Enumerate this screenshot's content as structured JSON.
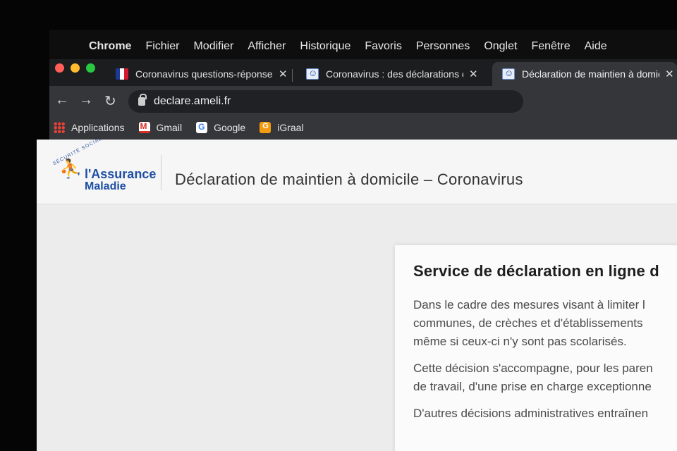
{
  "menubar": {
    "items": [
      "Chrome",
      "Fichier",
      "Modifier",
      "Afficher",
      "Historique",
      "Favoris",
      "Personnes",
      "Onglet",
      "Fenêtre",
      "Aide"
    ]
  },
  "tabs": [
    {
      "title": "Coronavirus questions-réponses",
      "favicon": "french-flag-icon"
    },
    {
      "title": "Coronavirus : des déclarations d",
      "favicon": "ameli-icon"
    },
    {
      "title": "Déclaration de maintien à domicil",
      "favicon": "ameli-icon",
      "active": true
    }
  ],
  "toolbar": {
    "url": "declare.ameli.fr"
  },
  "bookmarks": [
    {
      "label": "Applications",
      "icon": "apps-grid-icon"
    },
    {
      "label": "Gmail",
      "icon": "gmail-icon"
    },
    {
      "label": "Google",
      "icon": "google-icon"
    },
    {
      "label": "iGraal",
      "icon": "igraal-icon"
    }
  ],
  "site": {
    "logo_top": "SÉCURITÉ SOCIALE",
    "logo_line1": "l'Assurance",
    "logo_line2": "Maladie",
    "page_title": "Déclaration de maintien à domicile – Coronavirus"
  },
  "card": {
    "heading": "Service de déclaration en ligne d",
    "p1": [
      "Dans le cadre des mesures visant à limiter l",
      "communes, de crèches et d'établissements",
      "même si ceux-ci n'y sont pas scolarisés."
    ],
    "p2": [
      "Cette décision s'accompagne, pour les paren",
      "de travail, d'une prise en charge exceptionne"
    ],
    "p3": [
      "D'autres décisions administratives entraînen"
    ]
  },
  "colors": {
    "accent": "#1f4fa3",
    "tab_active": "#35363a",
    "page_bg": "#ececec"
  }
}
